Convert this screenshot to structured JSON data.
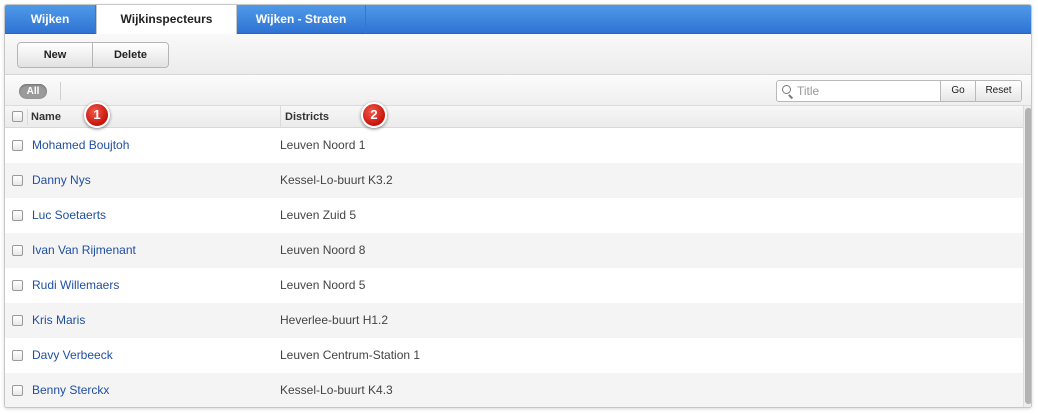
{
  "tabs": [
    {
      "label": "Wijken",
      "active": false
    },
    {
      "label": "Wijkinspecteurs",
      "active": true
    },
    {
      "label": "Wijken - Straten",
      "active": false
    }
  ],
  "toolbar": {
    "new_label": "New",
    "delete_label": "Delete"
  },
  "filter": {
    "all_label": "All",
    "search_placeholder": "Title",
    "search_value": "",
    "go_label": "Go",
    "reset_label": "Reset"
  },
  "table": {
    "columns": [
      "Name",
      "Districts"
    ],
    "rows": [
      {
        "name": "Mohamed Boujtoh",
        "district": "Leuven Noord 1"
      },
      {
        "name": "Danny Nys",
        "district": "Kessel-Lo-buurt K3.2"
      },
      {
        "name": "Luc Soetaerts",
        "district": "Leuven Zuid 5"
      },
      {
        "name": "Ivan Van Rijmenant",
        "district": "Leuven Noord 8"
      },
      {
        "name": "Rudi Willemaers",
        "district": "Leuven Noord 5"
      },
      {
        "name": "Kris Maris",
        "district": "Heverlee-buurt H1.2"
      },
      {
        "name": "Davy Verbeeck",
        "district": "Leuven Centrum-Station 1"
      },
      {
        "name": "Benny Sterckx",
        "district": "Kessel-Lo-buurt K4.3"
      }
    ]
  },
  "markers": [
    "1",
    "2"
  ],
  "colors": {
    "tab_bar": "#2f73d3",
    "link": "#1f4fa3",
    "marker": "#d5190f"
  }
}
